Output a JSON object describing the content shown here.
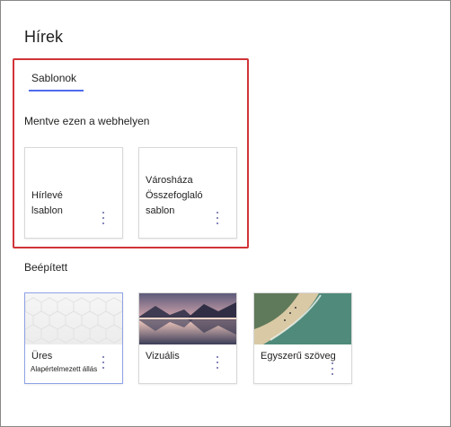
{
  "page": {
    "title": "Hírek"
  },
  "templates_panel": {
    "tab_label": "Sablonok",
    "saved_section_label": "Mentve ezen a webhelyen",
    "saved_cards": [
      {
        "title_lines": [
          "Hírlevé",
          "lsablon"
        ]
      },
      {
        "title_lines": [
          "Városháza",
          "Összefoglaló",
          "sablon"
        ]
      }
    ]
  },
  "builtin": {
    "section_label": "Beépített",
    "cards": [
      {
        "title": "Üres",
        "subtitle": "Alapértelmezett állás",
        "thumbnail": "white-hexagon-pattern",
        "selected": true
      },
      {
        "title": "Vizuális",
        "thumbnail": "mountain-lake-sunset"
      },
      {
        "title": "Egyszerű szöveg",
        "thumbnail": "aerial-beach-coast"
      }
    ]
  },
  "colors": {
    "accent": "#4f6bed",
    "highlight_border": "#d13438",
    "more_dots": "#6264a7"
  },
  "icons": {
    "more": "more-vertical-icon"
  }
}
